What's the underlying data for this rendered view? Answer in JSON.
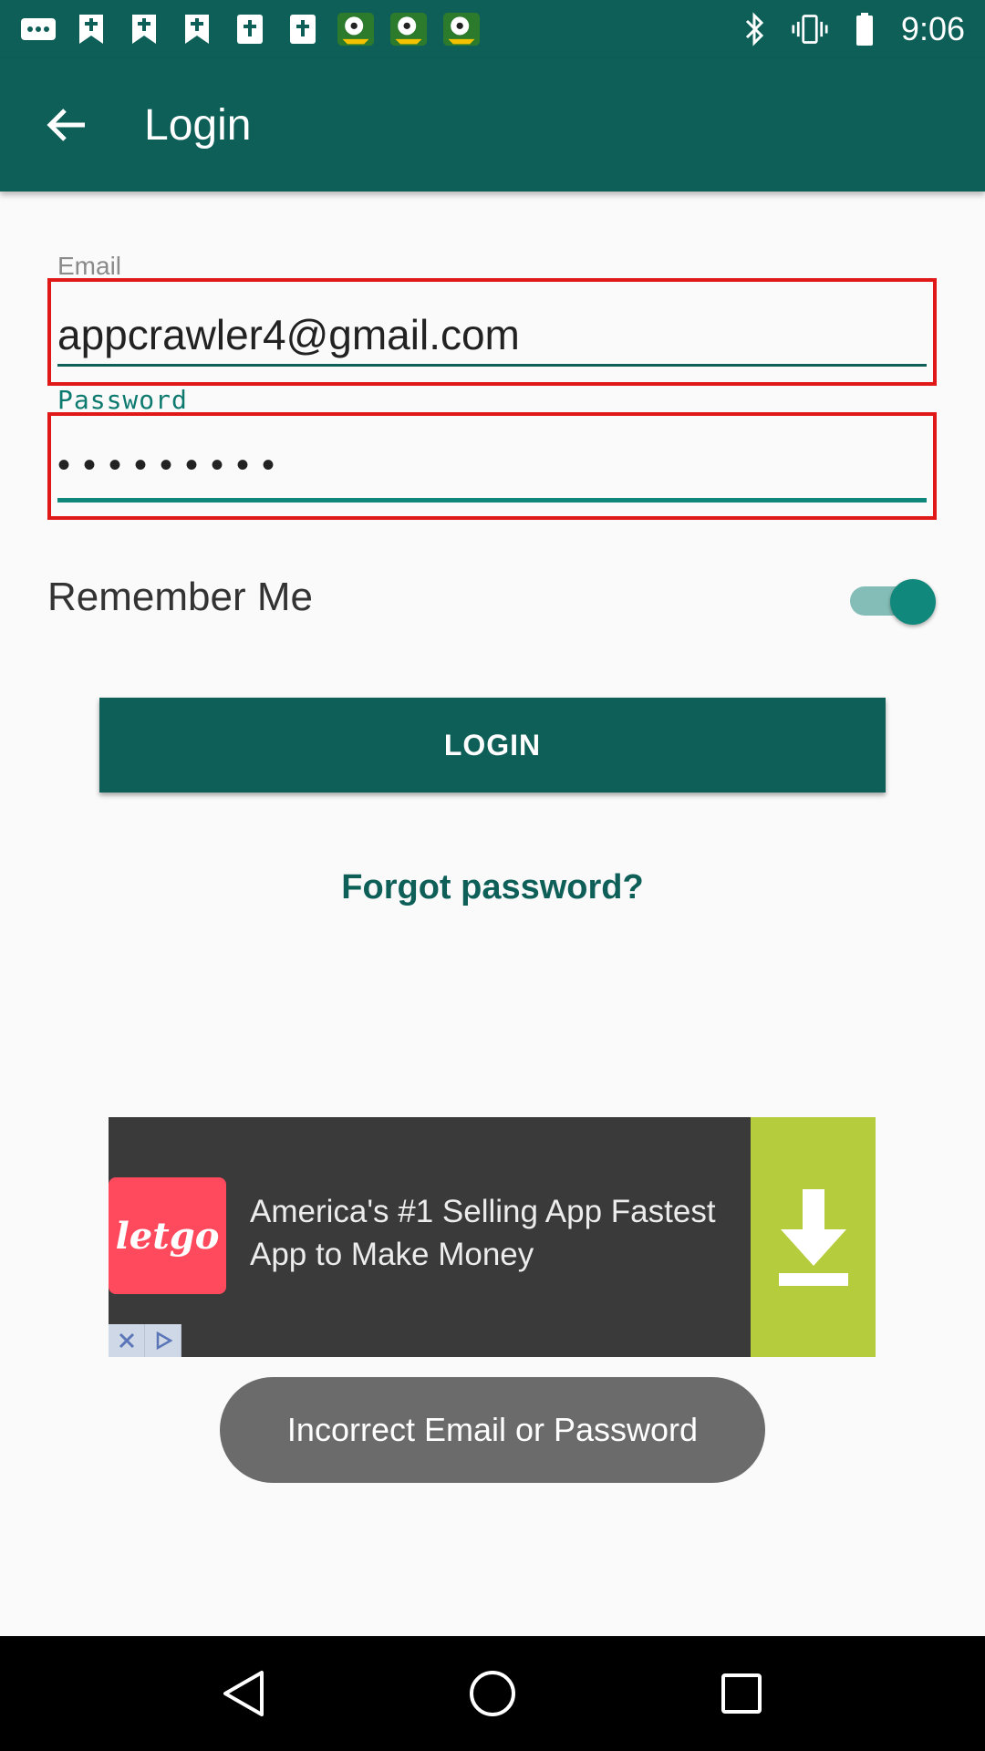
{
  "status_bar": {
    "time": "9:06",
    "notification_icons": [
      "more-icon",
      "bookmark-icon",
      "bookmark-icon",
      "bookmark-icon",
      "bible-icon",
      "bible-icon",
      "soccer-icon",
      "soccer-icon",
      "soccer-icon"
    ],
    "system_icons": [
      "bluetooth-icon",
      "vibrate-icon",
      "battery-icon"
    ]
  },
  "app_bar": {
    "title": "Login"
  },
  "form": {
    "email_label": "Email",
    "email_value": "appcrawler4@gmail.com",
    "password_label": "Password",
    "password_masked": "•••••••••",
    "remember_label": "Remember Me",
    "remember_on": true,
    "login_label": "LOGIN",
    "forgot_label": "Forgot password?"
  },
  "ad": {
    "logo_text": "letgo",
    "text": "America's #1 Selling App Fastest App to Make Money"
  },
  "toast": {
    "message": "Incorrect Email or Password"
  },
  "colors": {
    "primary": "#0d5f58",
    "accent": "#11887c",
    "highlight": "#e01818",
    "ad_green": "#b5cc3c",
    "letgo_red": "#ff4a5e"
  }
}
